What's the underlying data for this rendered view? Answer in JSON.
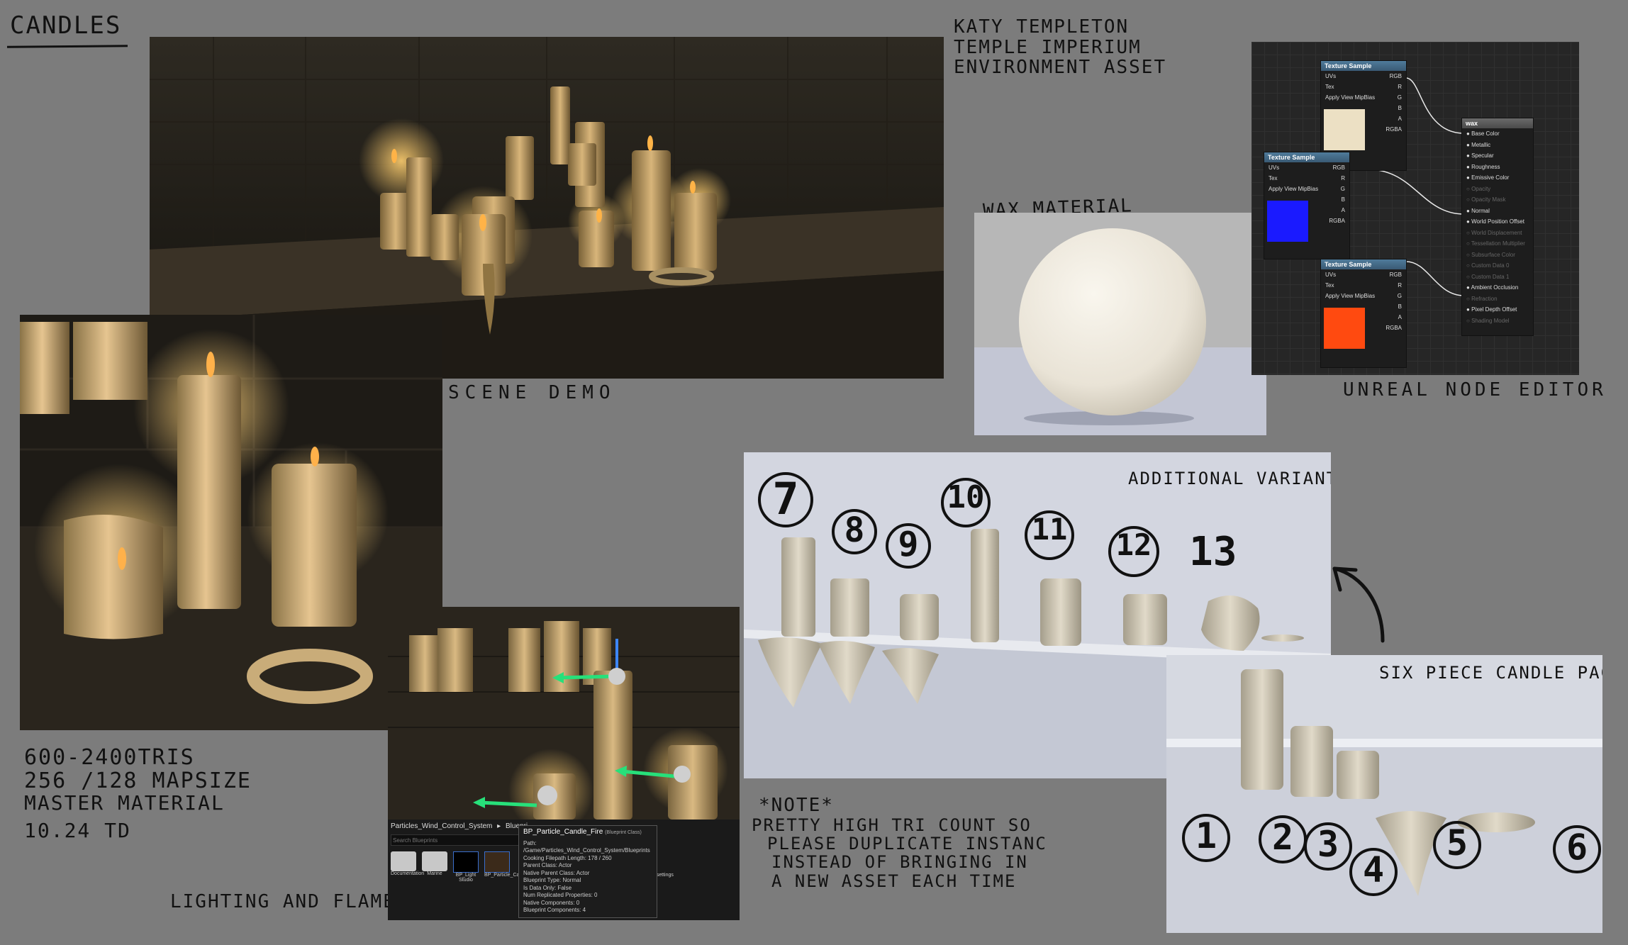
{
  "header": {
    "title": "CANDLES",
    "author": "KATY TEMPLETON",
    "project": "TEMPLE IMPERIUM",
    "asset_type": "ENVIRONMENT ASSET"
  },
  "labels": {
    "scene_demo": "SCENE DEMO",
    "wax_material": "WAX MATERIAL",
    "node_editor": "UNREAL NODE EDITOR",
    "variants": "ADDITIONAL VARIANTS",
    "pack": "SIX PIECE CANDLE PACK",
    "lighting": "LIGHTING AND FLAME"
  },
  "specs": {
    "tris": "600-2400TRIS",
    "map_size": "256 /128 MAPSIZE",
    "material": "MASTER MATERIAL",
    "td": "10.24 TD"
  },
  "note": {
    "heading": "*NOTE*",
    "line1": "PRETTY HIGH TRI COUNT SO",
    "line2": "PLEASE DUPLICATE INSTANC",
    "line3": "INSTEAD OF BRINGING IN",
    "line4": "A NEW ASSET EACH TIME"
  },
  "node_editor": {
    "texture_nodes": [
      {
        "title": "Texture Sample",
        "pins_left": [
          "UVs",
          "Tex",
          "Apply View MipBias"
        ],
        "pins_right": [
          "RGB",
          "R",
          "G",
          "B",
          "A",
          "RGBA"
        ],
        "swatch": "#ece0c4"
      },
      {
        "title": "Texture Sample",
        "pins_left": [
          "UVs",
          "Tex",
          "Apply View MipBias"
        ],
        "pins_right": [
          "RGB",
          "R",
          "G",
          "B",
          "A",
          "RGBA"
        ],
        "swatch": "#1a1aff"
      },
      {
        "title": "Texture Sample",
        "pins_left": [
          "UVs",
          "Tex",
          "Apply View MipBias"
        ],
        "pins_right": [
          "RGB",
          "R",
          "G",
          "B",
          "A",
          "RGBA"
        ],
        "swatch": "#ff4a10"
      }
    ],
    "wax_node": {
      "title": "wax",
      "inputs": [
        {
          "label": "Base Color",
          "active": true
        },
        {
          "label": "Metallic",
          "active": true
        },
        {
          "label": "Specular",
          "active": true
        },
        {
          "label": "Roughness",
          "active": true
        },
        {
          "label": "Emissive Color",
          "active": true
        },
        {
          "label": "Opacity",
          "active": false
        },
        {
          "label": "Opacity Mask",
          "active": false
        },
        {
          "label": "Normal",
          "active": true
        },
        {
          "label": "World Position Offset",
          "active": true
        },
        {
          "label": "World Displacement",
          "active": false
        },
        {
          "label": "Tessellation Multiplier",
          "active": false
        },
        {
          "label": "Subsurface Color",
          "active": false
        },
        {
          "label": "Custom Data 0",
          "active": false
        },
        {
          "label": "Custom Data 1",
          "active": false
        },
        {
          "label": "Ambient Occlusion",
          "active": true
        },
        {
          "label": "Refraction",
          "active": false
        },
        {
          "label": "Pixel Depth Offset",
          "active": true
        },
        {
          "label": "Shading Model",
          "active": false
        }
      ]
    }
  },
  "ue_editor": {
    "breadcrumb_1": "Particles_Wind_Control_System",
    "breadcrumb_sep": "▸",
    "breadcrumb_2": "Bluepri",
    "search_placeholder": "Search Blueprints",
    "assets": [
      "Documentation",
      "Marine",
      "BP_Light Studio",
      "BP_Particle_Candle_Fire",
      "BP_Particle_wind_settings"
    ],
    "tooltip": {
      "title": "BP_Particle_Candle_Fire",
      "subtitle": "(Blueprint Class)",
      "path": "Path: /Game/Particles_Wind_Control_System/Blueprints",
      "cooking": "Cooking Filepath Length: 178 / 260",
      "parent": "Parent Class: Actor",
      "native_parent": "Native Parent Class: Actor",
      "bp_type": "Blueprint Type: Normal",
      "data_only": "Is Data Only: False",
      "replicated": "Num Replicated Properties: 0",
      "native_comp": "Native Components: 0",
      "bp_comp": "Blueprint Components: 4"
    }
  },
  "variant_numbers": [
    "7",
    "8",
    "9",
    "10",
    "11",
    "12",
    "13"
  ],
  "pack_numbers": [
    "1",
    "2",
    "3",
    "4",
    "5",
    "6"
  ],
  "colors": {
    "background": "#7c7c7c",
    "wax": "#d8cfbd",
    "flame": "#ffb347",
    "gizmo_green": "#27e07a"
  }
}
